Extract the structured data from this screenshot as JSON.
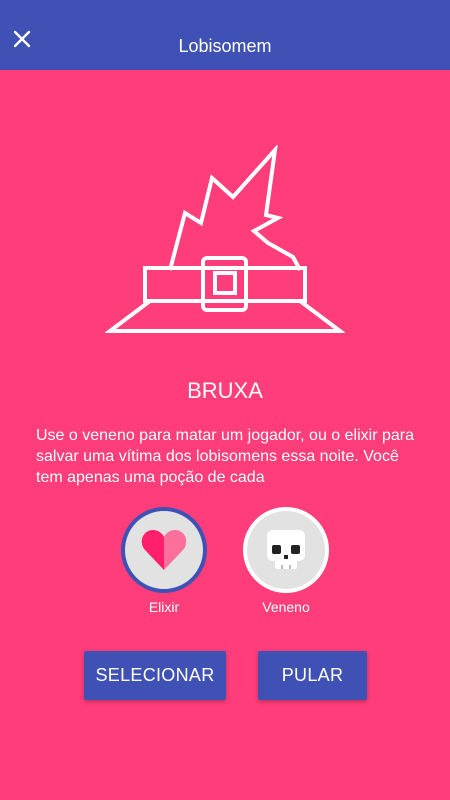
{
  "header": {
    "title": "Lobisomem",
    "close_icon": "close-icon"
  },
  "role": {
    "name": "BRUXA",
    "description": "Use o veneno para matar um jogador, ou o elixir para salvar uma vítima dos lobisomens essa noite. Você tem apenas uma poção de cada",
    "icon": "witch-hat-icon"
  },
  "potions": [
    {
      "label": "Elixir",
      "icon": "heart-icon",
      "selected": true
    },
    {
      "label": "Veneno",
      "icon": "skull-icon",
      "selected": false
    }
  ],
  "actions": {
    "select_label": "SELECIONAR",
    "skip_label": "PULAR"
  },
  "colors": {
    "background": "#ff3d7a",
    "header": "#3f51b5",
    "button": "#3f51b5",
    "heart": "#ff1f6b",
    "potion_circle": "#e2e2e2"
  }
}
